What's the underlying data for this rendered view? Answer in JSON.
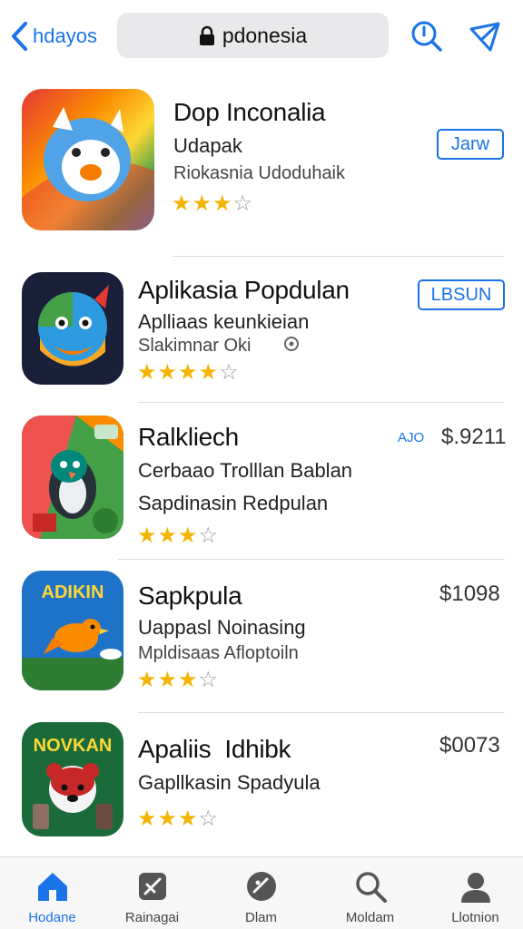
{
  "header": {
    "back_label": "hdayos",
    "url": "pdonesia"
  },
  "apps": [
    {
      "title": "Dop Inconalia",
      "subtitle": "Udapak",
      "subtitle2": "Riokasnia Udoduhaik",
      "rating": 3,
      "action": {
        "kind": "button",
        "label": "Jarw"
      }
    },
    {
      "title": "Aplikasia Popdulan",
      "subtitle": "Aplliaas keunkieian",
      "subtitle2": "Slakimnar Oki",
      "rating": 4,
      "action": {
        "kind": "button",
        "label": "LBSUN"
      }
    },
    {
      "title": "Ralkliech",
      "subtitle": "Cerbaao Trolllan Bablan",
      "subtitle2": "Sapdinasin Redpulan",
      "rating": 3,
      "action": {
        "kind": "price",
        "tag": "AJO",
        "label": "$.9211"
      }
    },
    {
      "title": "Sapkpula",
      "subtitle": "Uappasl Noinasing",
      "subtitle2": "Mpldisaas Afloptoiln",
      "rating": 3,
      "action": {
        "kind": "price",
        "label": "$1098"
      }
    },
    {
      "title": "Apaliis  Idhibk",
      "subtitle": "Gapllkasin Spadyula",
      "subtitle2": "",
      "rating": 3,
      "action": {
        "kind": "price",
        "label": "$0073"
      }
    }
  ],
  "tabs": [
    {
      "label": "Hodane",
      "icon": "home-icon",
      "active": true
    },
    {
      "label": "Rainagai",
      "icon": "apps-icon",
      "active": false
    },
    {
      "label": "Dlam",
      "icon": "games-icon",
      "active": false
    },
    {
      "label": "Moldam",
      "icon": "search-icon",
      "active": false
    },
    {
      "label": "Llotnion",
      "icon": "account-icon",
      "active": false
    }
  ],
  "colors": {
    "accent": "#1a73e8",
    "star": "#f5b400"
  }
}
